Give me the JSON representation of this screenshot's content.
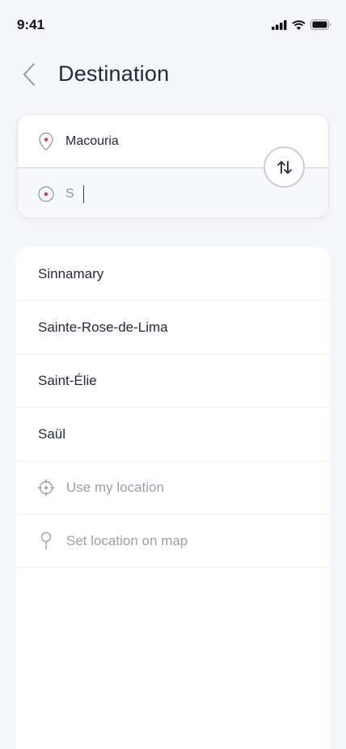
{
  "status_bar": {
    "time": "9:41",
    "icons": [
      "signal-icon",
      "wifi-icon",
      "battery-icon"
    ]
  },
  "header": {
    "title": "Destination",
    "back_icon": "chevron-left-icon"
  },
  "route": {
    "origin": "Macouria",
    "destination_value": "S",
    "swap_icon": "swap-vertical-icon",
    "pin_color": "#d8315b"
  },
  "results": [
    {
      "label": "Sinnamary"
    },
    {
      "label": "Sainte-Rose-de-Lima"
    },
    {
      "label": "Saint-Élie"
    },
    {
      "label": "Saül"
    }
  ],
  "actions": {
    "use_location": {
      "label": "Use my location",
      "icon": "crosshair-icon"
    },
    "set_on_map": {
      "label": "Set location on map",
      "icon": "map-pin-icon"
    }
  }
}
